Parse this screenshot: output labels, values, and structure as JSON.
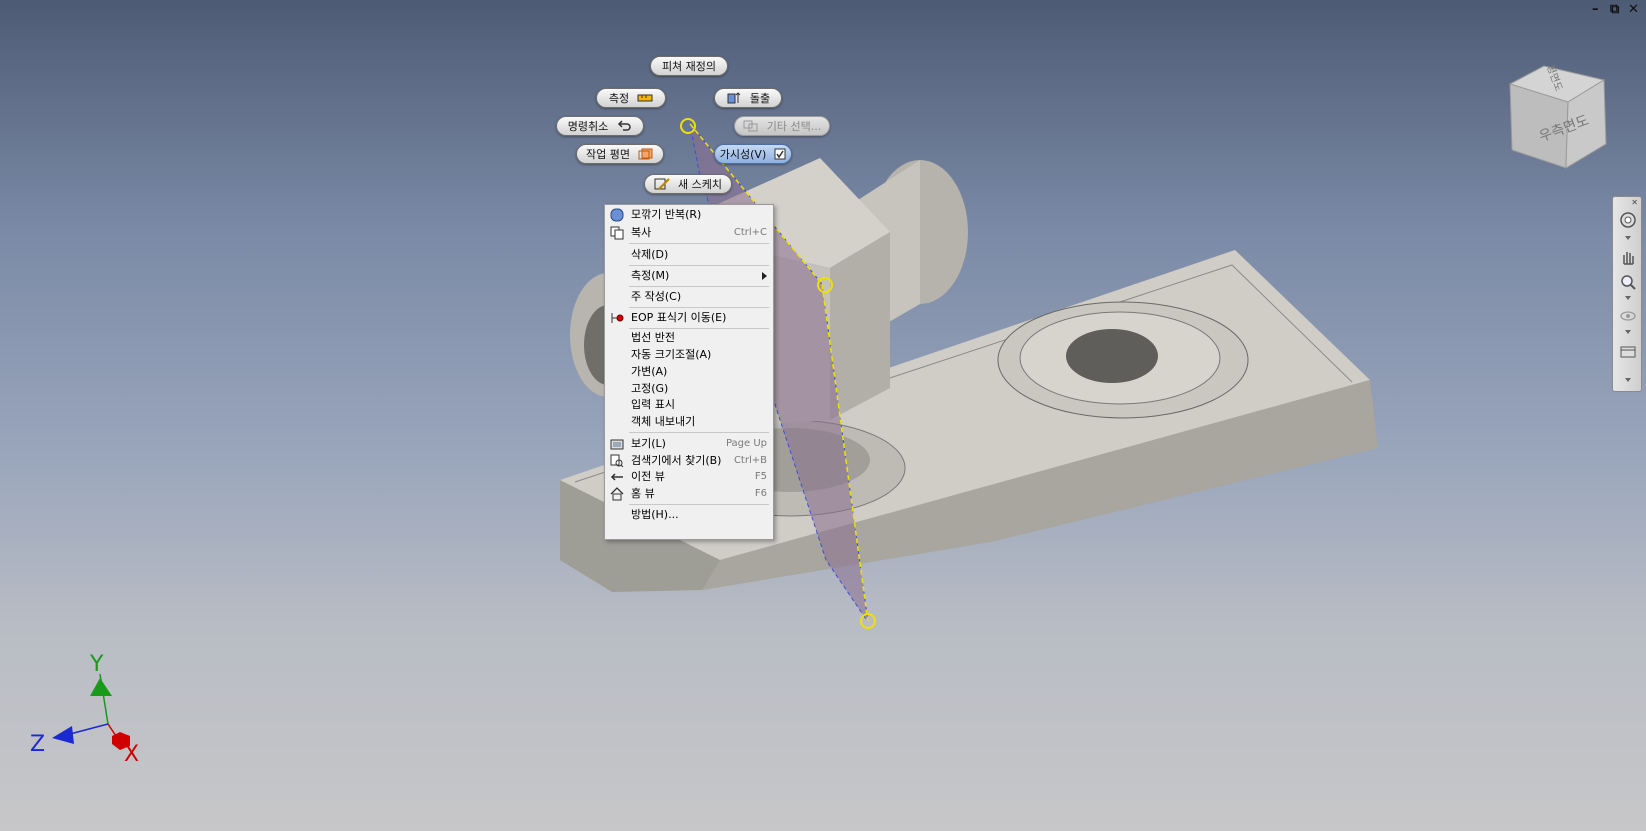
{
  "window_controls": {
    "minimize": "–",
    "restore": "⧉",
    "close": "✕"
  },
  "viewcube": {
    "face_right": "우측면도",
    "face_top": "평면도"
  },
  "mini_toolbar": {
    "redefine_feature": "피쳐 재정의",
    "measure": "측정",
    "extrude": "돌출",
    "undo": "명령취소",
    "other_select": "기타 선택...",
    "work_plane": "작업 평면",
    "visibility": "가시성(V)",
    "new_sketch": "새 스케치"
  },
  "context_menu": {
    "items": [
      {
        "label": "모깎기 반복(R)",
        "shortcut": "",
        "icon": "fillet-icon"
      },
      {
        "label": "복사",
        "shortcut": "Ctrl+C",
        "icon": "copy-icon"
      },
      {
        "label": "삭제(D)",
        "shortcut": "",
        "icon": ""
      },
      {
        "label": "측정(M)",
        "shortcut": "",
        "icon": "",
        "submenu": true
      },
      {
        "label": "주 작성(C)",
        "shortcut": "",
        "icon": ""
      },
      {
        "label": "EOP 표식기 이동(E)",
        "shortcut": "",
        "icon": "eop-marker-icon"
      },
      {
        "label": "법선 반전",
        "shortcut": "",
        "icon": ""
      },
      {
        "label": "자동 크기조절(A)",
        "shortcut": "",
        "icon": ""
      },
      {
        "label": "가변(A)",
        "shortcut": "",
        "icon": ""
      },
      {
        "label": "고정(G)",
        "shortcut": "",
        "icon": ""
      },
      {
        "label": "입력 표시",
        "shortcut": "",
        "icon": ""
      },
      {
        "label": "객체 내보내기",
        "shortcut": "",
        "icon": ""
      },
      {
        "label": "보기(L)",
        "shortcut": "Page Up",
        "icon": "view-icon"
      },
      {
        "label": "검색기에서 찾기(B)",
        "shortcut": "Ctrl+B",
        "icon": "find-in-browser-icon"
      },
      {
        "label": "이전 뷰",
        "shortcut": "F5",
        "icon": "previous-view-icon"
      },
      {
        "label": "홈 뷰",
        "shortcut": "F6",
        "icon": "home-view-icon"
      },
      {
        "label": "방법(H)...",
        "shortcut": "",
        "icon": ""
      }
    ]
  },
  "axis_triad": {
    "x": "X",
    "y": "Y",
    "z": "Z"
  },
  "colors": {
    "plane_fill": "#8a6f8f",
    "plane_edge_yellow": "#f0e000",
    "axis_x": "#d00000",
    "axis_y": "#1a9a1a",
    "axis_z": "#1a2ad0"
  }
}
